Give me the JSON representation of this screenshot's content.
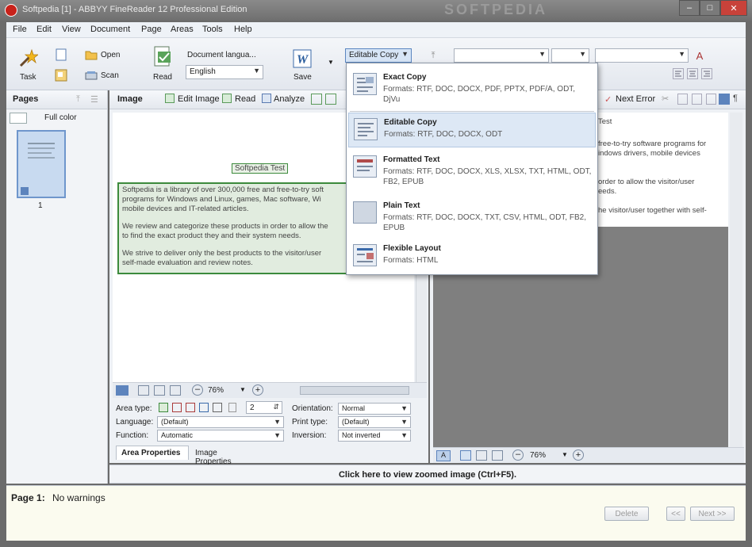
{
  "window": {
    "title": "Softpedia [1] - ABBYY FineReader 12 Professional Edition",
    "watermark": "SOFTPEDIA"
  },
  "menu": [
    "File",
    "Edit",
    "View",
    "Document",
    "Page",
    "Areas",
    "Tools",
    "Help"
  ],
  "toolbar": {
    "task_label": "Task",
    "open_label": "Open",
    "scan_label": "Scan",
    "read_label": "Read",
    "doc_language_label": "Document langua...",
    "doc_language_value": "English",
    "save_label": "Save",
    "save_format_value": "Editable Copy",
    "font_value": "",
    "size_value": ""
  },
  "dropdown": {
    "items": [
      {
        "name": "Exact Copy",
        "formats": "Formats: RTF, DOC, DOCX, PDF, PPTX, PDF/A, ODT, DjVu",
        "icon": "exact-copy-icon"
      },
      {
        "name": "Editable Copy",
        "formats": "Formats: RTF, DOC, DOCX, ODT",
        "icon": "editable-copy-icon"
      },
      {
        "name": "Formatted Text",
        "formats": "Formats: RTF, DOC, DOCX, XLS, XLSX, TXT, HTML, ODT, FB2, EPUB",
        "icon": "formatted-text-icon"
      },
      {
        "name": "Plain Text",
        "formats": "Formats: RTF, DOC, DOCX, TXT, CSV, HTML, ODT, FB2, EPUB",
        "icon": "plain-text-icon"
      },
      {
        "name": "Flexible Layout",
        "formats": "Formats: HTML",
        "icon": "flexible-layout-icon"
      }
    ],
    "selected_index": 1
  },
  "pages_pane": {
    "title": "Pages",
    "color_mode": "Full color",
    "page_number": "1"
  },
  "image_pane": {
    "title": "Image",
    "edit_image": "Edit Image",
    "read": "Read",
    "analyze": "Analyze",
    "doc_title": "Softpedia Test",
    "doc_lines": [
      "Softpedia is a library of over 300,000 free and free-to-try soft",
      "programs for Windows and Linux, games, Mac software, Wi",
      "mobile devices and IT-related articles.",
      "",
      "We review and categorize these products in order to allow the",
      "to find the exact product they and their system needs.",
      "",
      "We strive to deliver only the best products to the visitor/user",
      "self-made evaluation and review notes."
    ],
    "zoom": "76%",
    "props": {
      "area_type_label": "Area type:",
      "language_label": "Language:",
      "language_value": "(Default)",
      "function_label": "Function:",
      "function_value": "Automatic",
      "orientation_label": "Orientation:",
      "orientation_value": "Normal",
      "print_type_label": "Print type:",
      "print_type_value": "(Default)",
      "inversion_label": "Inversion:",
      "inversion_value": "Not inverted",
      "number_value": "2"
    },
    "tabs": [
      "Area Properties",
      "Image Properties"
    ]
  },
  "text_pane": {
    "next_error": "Next Error",
    "snippets": [
      "Test",
      "free-to-try software programs for",
      "indows drivers, mobile devices",
      "order to allow the visitor/user",
      "eeds.",
      "he visitor/user together with self-"
    ],
    "zoom": "76%"
  },
  "status": {
    "zoom_hint": "Click here to view zoomed image (Ctrl+F5).",
    "page_label": "Page 1:",
    "page_status": "No warnings",
    "delete_btn": "Delete",
    "prev_btn": "<<",
    "next_btn": "Next >>"
  },
  "colors": {
    "area_green": "#3c8a3c",
    "selection_blue": "#dde8f5",
    "accent_red": "#c8221b"
  }
}
